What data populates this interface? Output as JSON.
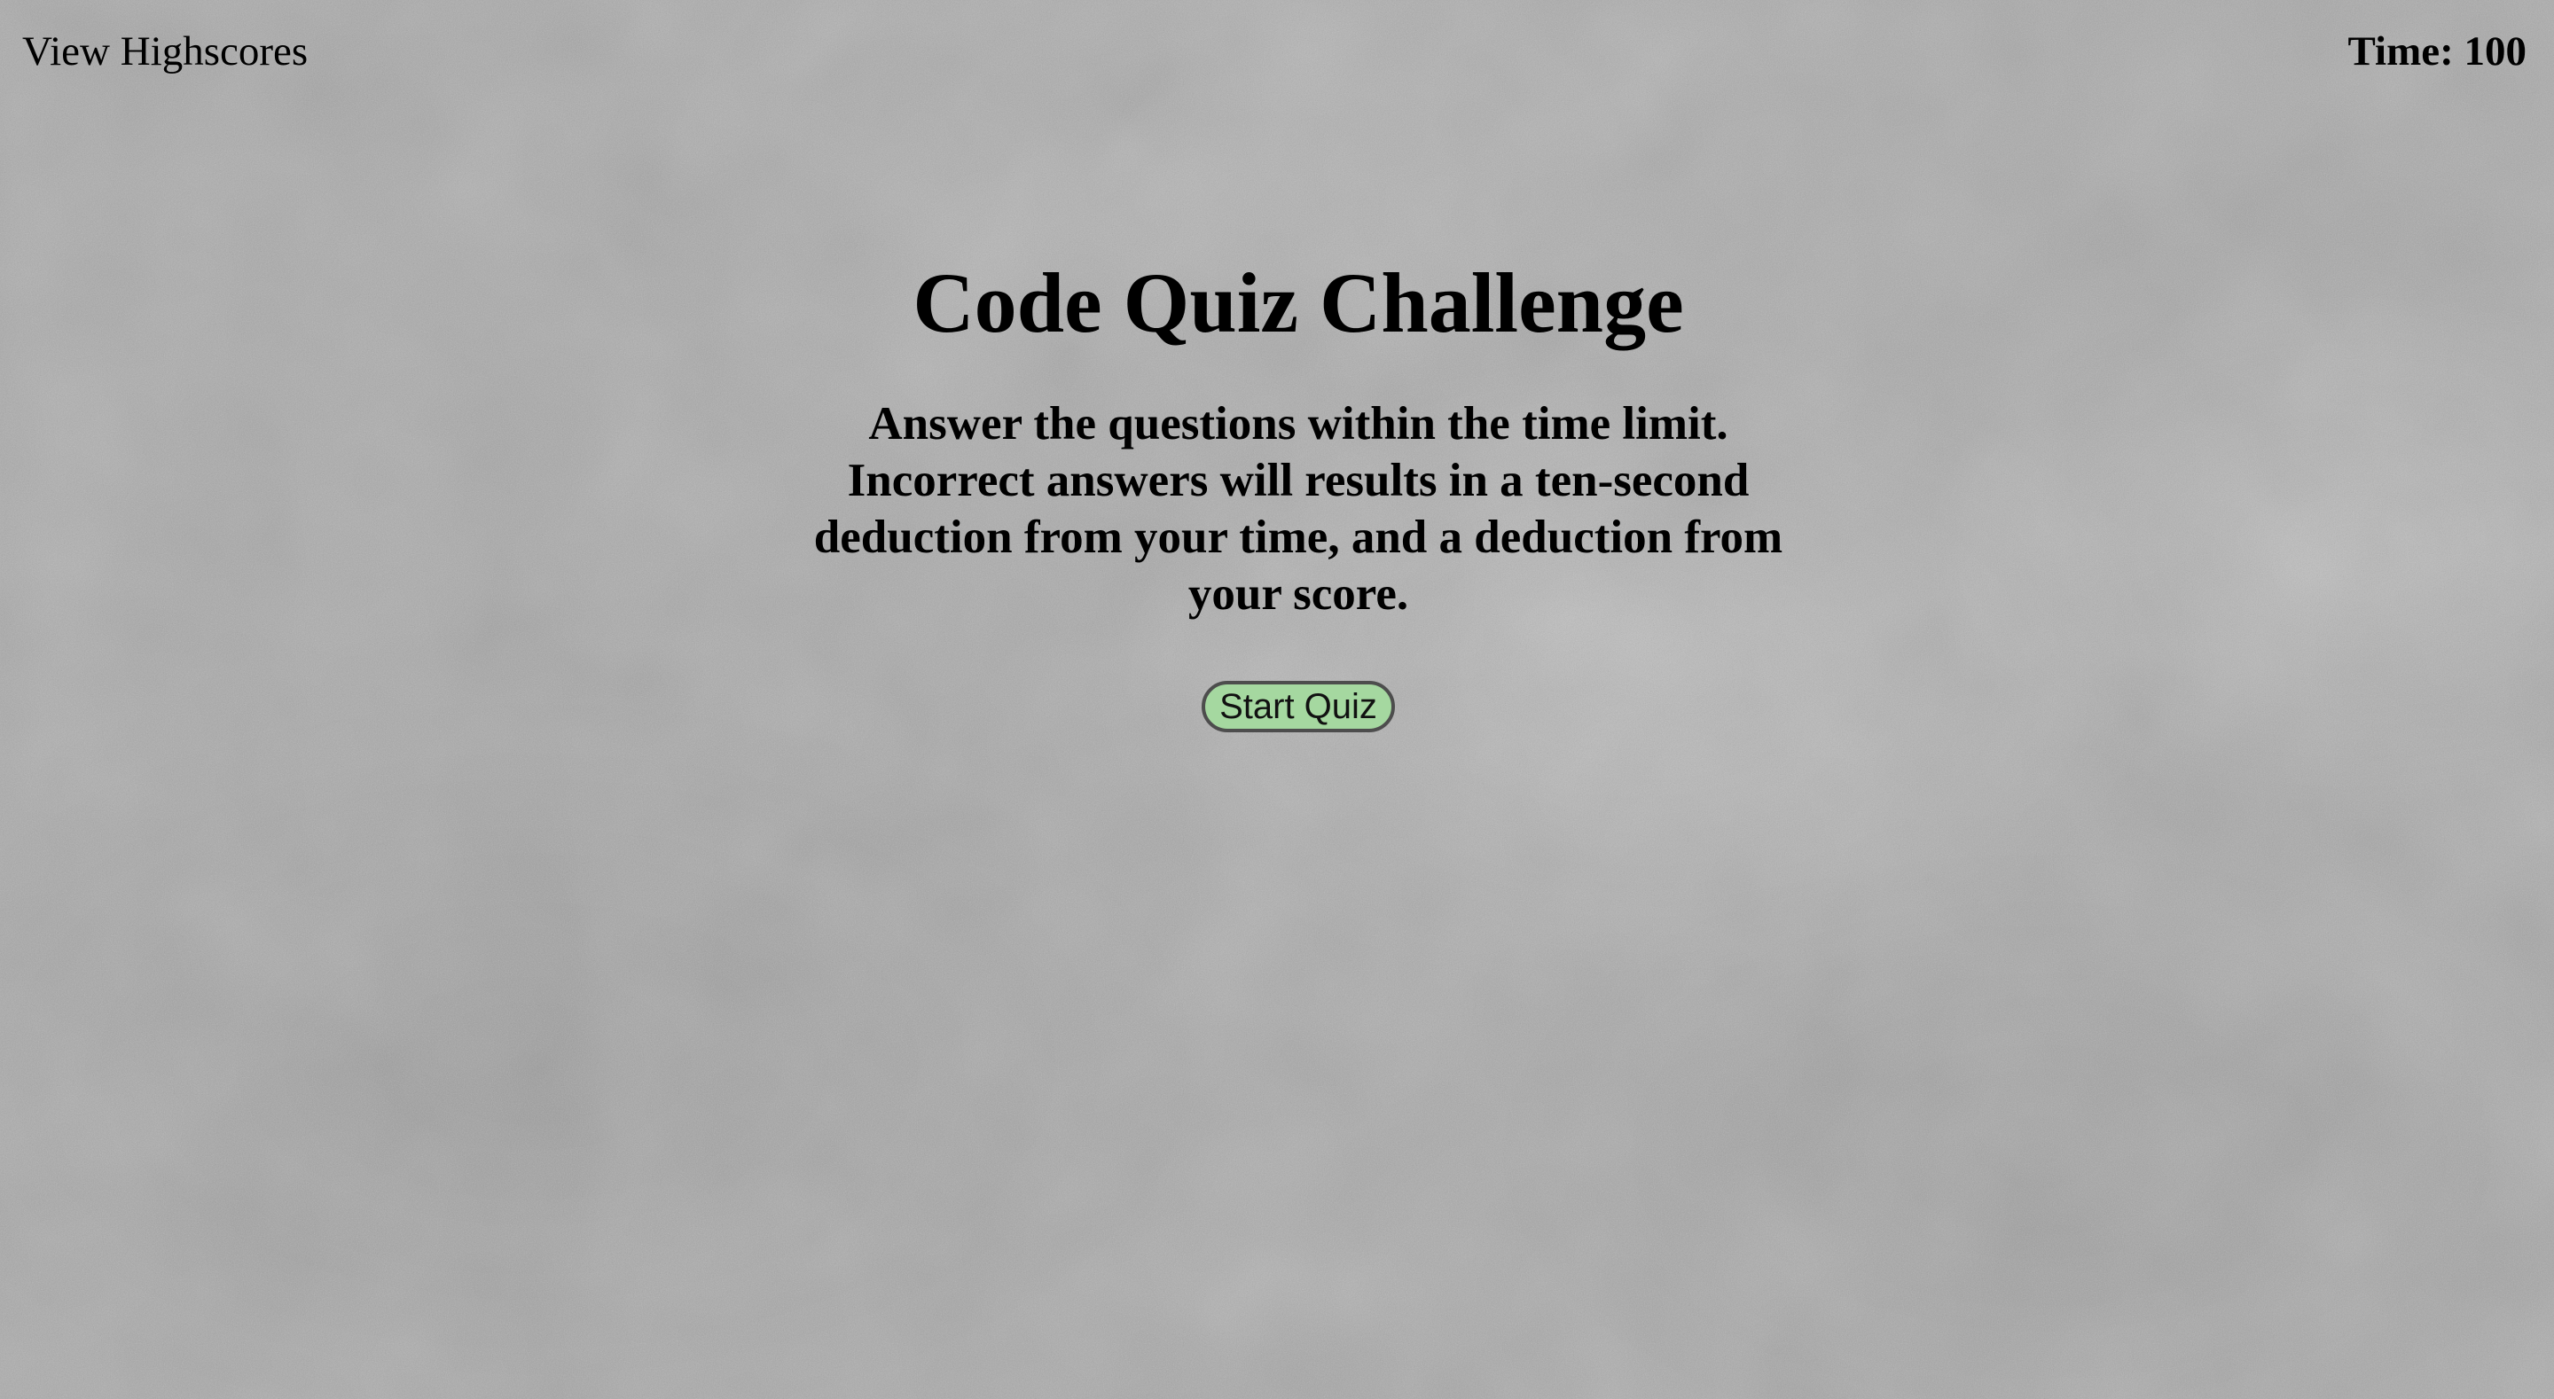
{
  "header": {
    "highscores_link": "View Highscores",
    "timer_label": "Time:",
    "timer_value": "100"
  },
  "main": {
    "title": "Code Quiz Challenge",
    "instructions": "Answer the questions within the time limit. Incorrect answers will results in a ten-second deduction from your time, and a deduction from your score.",
    "start_button": "Start Quiz"
  },
  "colors": {
    "background": "#a9a9a9",
    "button_fill": "#a5d8a0",
    "button_border": "#4d4d4d",
    "text": "#000000"
  }
}
